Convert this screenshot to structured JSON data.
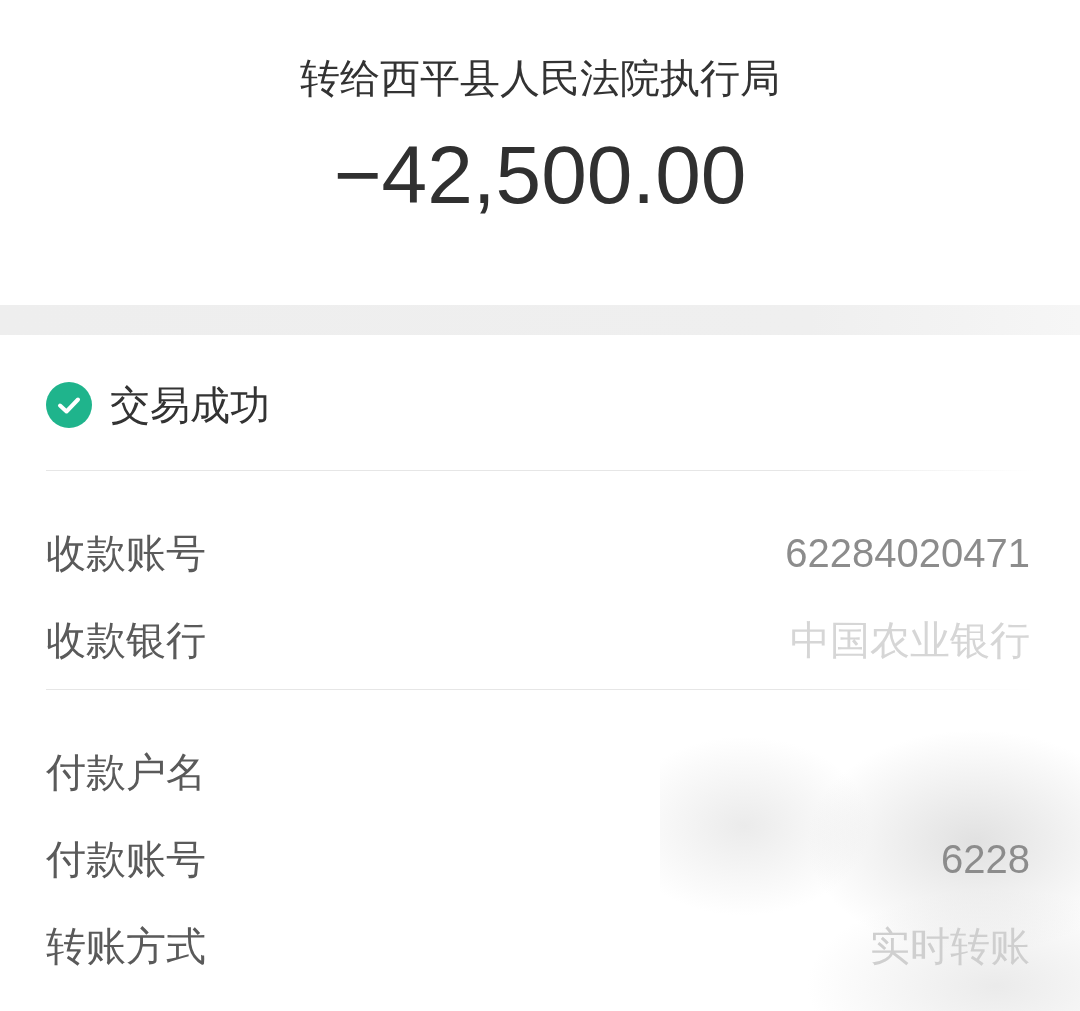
{
  "header": {
    "title": "转给西平县人民法院执行局",
    "amount": "−42,500.00"
  },
  "status": {
    "kind": "success",
    "label": "交易成功"
  },
  "sections": [
    {
      "rows": [
        {
          "label": "收款账号",
          "value": "62284020471"
        },
        {
          "label": "收款银行",
          "value": "中国农业银行"
        }
      ]
    },
    {
      "rows": [
        {
          "label": "付款户名"
        },
        {
          "label": "付款账号",
          "value": "6228"
        },
        {
          "label": "转账方式",
          "value": "实时转账"
        }
      ]
    }
  ]
}
